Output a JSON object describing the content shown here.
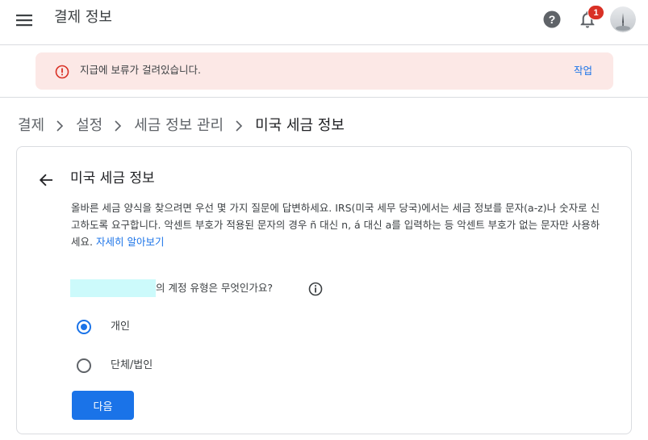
{
  "header": {
    "title": "결제 정보",
    "notification_count": "1",
    "icons": {
      "menu": "hamburger-menu-icon",
      "help": "help-icon",
      "notifications": "bell-icon",
      "avatar": "user-avatar"
    }
  },
  "alert": {
    "text": "지급에 보류가 걸려있습니다.",
    "action": "작업",
    "icon": "error-icon"
  },
  "breadcrumb": {
    "items": [
      "결제",
      "설정",
      "세금 정보 관리",
      "미국 세금 정보"
    ]
  },
  "card": {
    "title": "미국 세금 정보",
    "description": "올바른 세금 양식을 찾으려면 우선 몇 가지 질문에 답변하세요. IRS(미국 세무 당국)에서는 세금 정보를 문자(a-z)나 숫자로 신고하도록 요구합니다. 악센트 부호가 적용된 문자의 경우 ñ 대신 n, á 대신 a를 입력하는 등 악센트 부호가 없는 문자만 사용하세요.",
    "learn_more": "자세히 알아보기",
    "question": "의 계정 유형은 무엇인가요?",
    "options": [
      {
        "label": "개인",
        "selected": true
      },
      {
        "label": "단체/법인",
        "selected": false
      }
    ],
    "next_button": "다음"
  },
  "colors": {
    "accent": "#1a73e8",
    "alert_bg": "#fce8e6",
    "error": "#d93025",
    "redaction": "#ccfafb"
  }
}
